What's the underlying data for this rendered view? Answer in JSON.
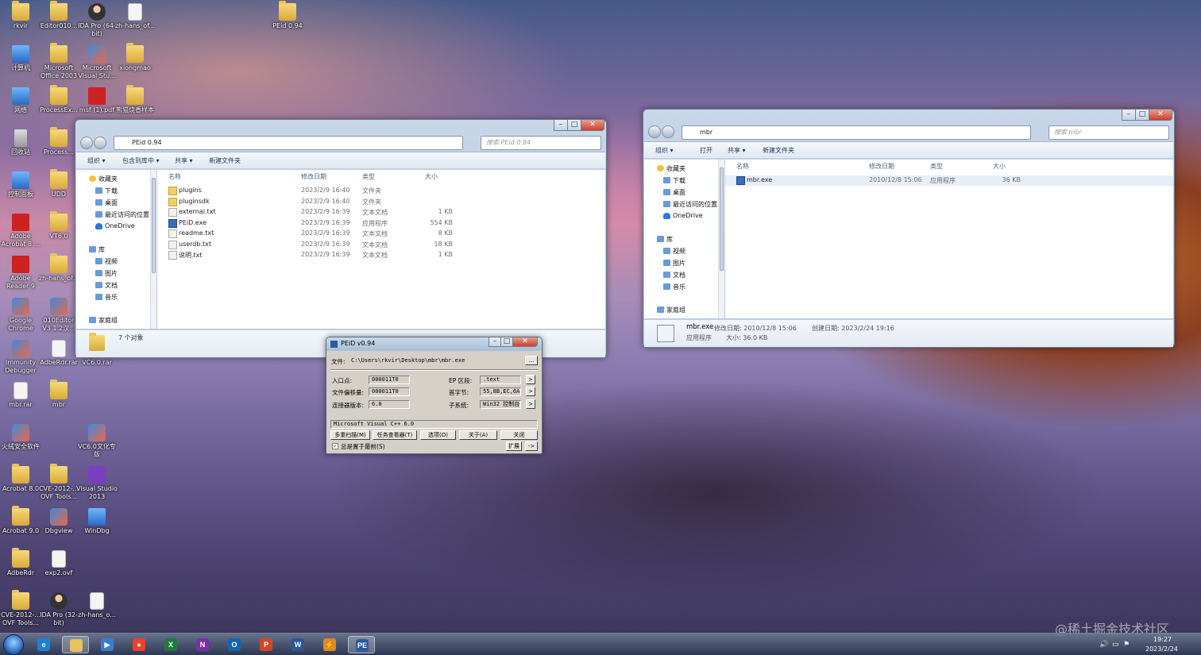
{
  "desktop_icons": [
    {
      "label": "rkvir",
      "type": "folder"
    },
    {
      "label": "Editor010...",
      "type": "folder"
    },
    {
      "label": "IDA Pro (64-bit)",
      "type": "person"
    },
    {
      "label": "zh-hans_of...",
      "type": "file"
    },
    {
      "label": "PEid 0.94",
      "type": "folder"
    },
    {
      "label": "计算机",
      "type": "comp"
    },
    {
      "label": "Microsoft Office 2003",
      "type": "folder"
    },
    {
      "label": "Microsoft Visual Stu...",
      "type": "app"
    },
    {
      "label": "xiongmao",
      "type": "folder"
    },
    {
      "label": "网络",
      "type": "comp"
    },
    {
      "label": "ProcessEx...",
      "type": "folder"
    },
    {
      "label": "msf (1).pdf",
      "type": "pdf"
    },
    {
      "label": "熊猫烧香样本",
      "type": "folder"
    },
    {
      "label": "回收站",
      "type": "bin"
    },
    {
      "label": "Process...",
      "type": "folder"
    },
    {
      "label": "控制面板",
      "type": "comp"
    },
    {
      "label": "UDD",
      "type": "folder"
    },
    {
      "label": "Adobe Acrobat 8 ...",
      "type": "pdf"
    },
    {
      "label": "VT6.0",
      "type": "folder"
    },
    {
      "label": "Adobe Reader 9",
      "type": "pdf"
    },
    {
      "label": "zh-hans_of...",
      "type": "folder"
    },
    {
      "label": "Google Chrome",
      "type": "app"
    },
    {
      "label": "010Editor V3.1.2汉...",
      "type": "app"
    },
    {
      "label": "Immunity Debugger",
      "type": "app"
    },
    {
      "label": "AdbeRdr.rar",
      "type": "file"
    },
    {
      "label": "VC6.0.rar",
      "type": "file"
    },
    {
      "label": "mbr.rar",
      "type": "file"
    },
    {
      "label": "mbr",
      "type": "folder"
    },
    {
      "label": "火绒安全软件",
      "type": "app"
    },
    {
      "label": "VC6.0文化专版",
      "type": "app"
    },
    {
      "label": "Acrobat 8.0",
      "type": "folder"
    },
    {
      "label": "CVE-2012-... OVF Tools...",
      "type": "folder"
    },
    {
      "label": "Visual Studio 2013",
      "type": "vs"
    },
    {
      "label": "Acrobat 9.0",
      "type": "folder"
    },
    {
      "label": "Dbgview",
      "type": "app"
    },
    {
      "label": "WinDbg",
      "type": "comp"
    },
    {
      "label": "AdbeRdr",
      "type": "folder"
    },
    {
      "label": "exp2.ovf",
      "type": "file"
    },
    {
      "label": "CVE-2012-... OVF Tools...",
      "type": "folder"
    },
    {
      "label": "IDA Pro (32-bit)",
      "type": "person"
    },
    {
      "label": "zh-hans_o...",
      "type": "file"
    }
  ],
  "explorer1": {
    "path": "PEid 0.94",
    "search_placeholder": "搜索 PEid 0.94",
    "commands": [
      "组织 ▾",
      "包含到库中 ▾",
      "共享 ▾",
      "新建文件夹"
    ],
    "nav": [
      "收藏夹",
      "下载",
      "桌面",
      "最近访问的位置",
      "OneDrive",
      "库",
      "视频",
      "图片",
      "文档",
      "音乐",
      "家庭组"
    ],
    "columns": [
      "名称",
      "修改日期",
      "类型",
      "大小"
    ],
    "files": [
      {
        "name": "plugins",
        "date": "2023/2/9 16:40",
        "type": "文件夹",
        "size": "",
        "kind": "folder"
      },
      {
        "name": "pluginsdk",
        "date": "2023/2/9 16:40",
        "type": "文件夹",
        "size": "",
        "kind": "folder"
      },
      {
        "name": "external.txt",
        "date": "2023/2/9 16:39",
        "type": "文本文档",
        "size": "1 KB",
        "kind": "txt"
      },
      {
        "name": "PEiD.exe",
        "date": "2023/2/9 16:39",
        "type": "应用程序",
        "size": "554 KB",
        "kind": "exe"
      },
      {
        "name": "readme.txt",
        "date": "2023/2/9 16:39",
        "type": "文本文档",
        "size": "8 KB",
        "kind": "txt"
      },
      {
        "name": "userdb.txt",
        "date": "2023/2/9 16:39",
        "type": "文本文档",
        "size": "18 KB",
        "kind": "txt"
      },
      {
        "name": "说明.txt",
        "date": "2023/2/9 16:39",
        "type": "文本文档",
        "size": "1 KB",
        "kind": "txt"
      }
    ],
    "status": "7 个对象"
  },
  "explorer2": {
    "path": "mbr",
    "search_placeholder": "搜索 mbr",
    "commands": [
      "组织 ▾",
      "打开",
      "共享 ▾",
      "新建文件夹"
    ],
    "nav": [
      "收藏夹",
      "下载",
      "桌面",
      "最近访问的位置",
      "OneDrive",
      "库",
      "视频",
      "图片",
      "文档",
      "音乐",
      "家庭组"
    ],
    "columns": [
      "名称",
      "修改日期",
      "类型",
      "大小"
    ],
    "files": [
      {
        "name": "mbr.exe",
        "date": "2010/12/8 15:06",
        "type": "应用程序",
        "size": "36 KB",
        "kind": "exe"
      }
    ],
    "detail": {
      "name": "mbr.exe",
      "kind": "应用程序",
      "modified_label": "修改日期: 2010/12/8 15:06",
      "created_label": "创建日期: 2023/2/24 19:16",
      "size_label": "大小: 36.0 KB"
    }
  },
  "peid": {
    "title": "PEiD v0.94",
    "file_label": "文件:",
    "file_value": "C:\\Users\\rkvir\\Desktop\\mbr\\mbr.exe",
    "browse": "...",
    "entry_label": "入口点:",
    "entry_value": "000011T0",
    "offset_label": "文件偏移量:",
    "offset_value": "000011T0",
    "linker_label": "连接器版本:",
    "linker_value": "6.0",
    "ep_label": "EP 区段:",
    "ep_value": ".text",
    "first_label": "首字节:",
    "first_value": "55,8B,EC,6A",
    "sub_label": "子系统:",
    "sub_value": "Win32 控制台",
    "arrow": ">",
    "result": "Microsoft Visual C++ 6.0",
    "buttons": [
      "多重扫描(M)",
      "任务查看器(T)",
      "选项(O)",
      "关于(A)",
      "关闭"
    ],
    "ontop": "总是置于最前(S)",
    "ext": "扩展",
    "ext_arrow": "->"
  },
  "taskbar": {
    "items": [
      {
        "glyph": "e",
        "color": "#1e7fd6"
      },
      {
        "glyph": "",
        "color": "#e8c25a"
      },
      {
        "glyph": "▶",
        "color": "#3a7bd5"
      },
      {
        "glyph": "●",
        "color": "#e8432b"
      },
      {
        "glyph": "X",
        "color": "#1d7a3e"
      },
      {
        "glyph": "N",
        "color": "#7a2fa8"
      },
      {
        "glyph": "O",
        "color": "#1464b4"
      },
      {
        "glyph": "P",
        "color": "#d24726"
      },
      {
        "glyph": "W",
        "color": "#2b5797"
      },
      {
        "glyph": "⚡",
        "color": "#e08a20"
      },
      {
        "glyph": "PE",
        "color": "#2c5aa0"
      }
    ],
    "time": "19:27",
    "date": "2023/2/24"
  },
  "watermark": "@稀土掘金技术社区"
}
